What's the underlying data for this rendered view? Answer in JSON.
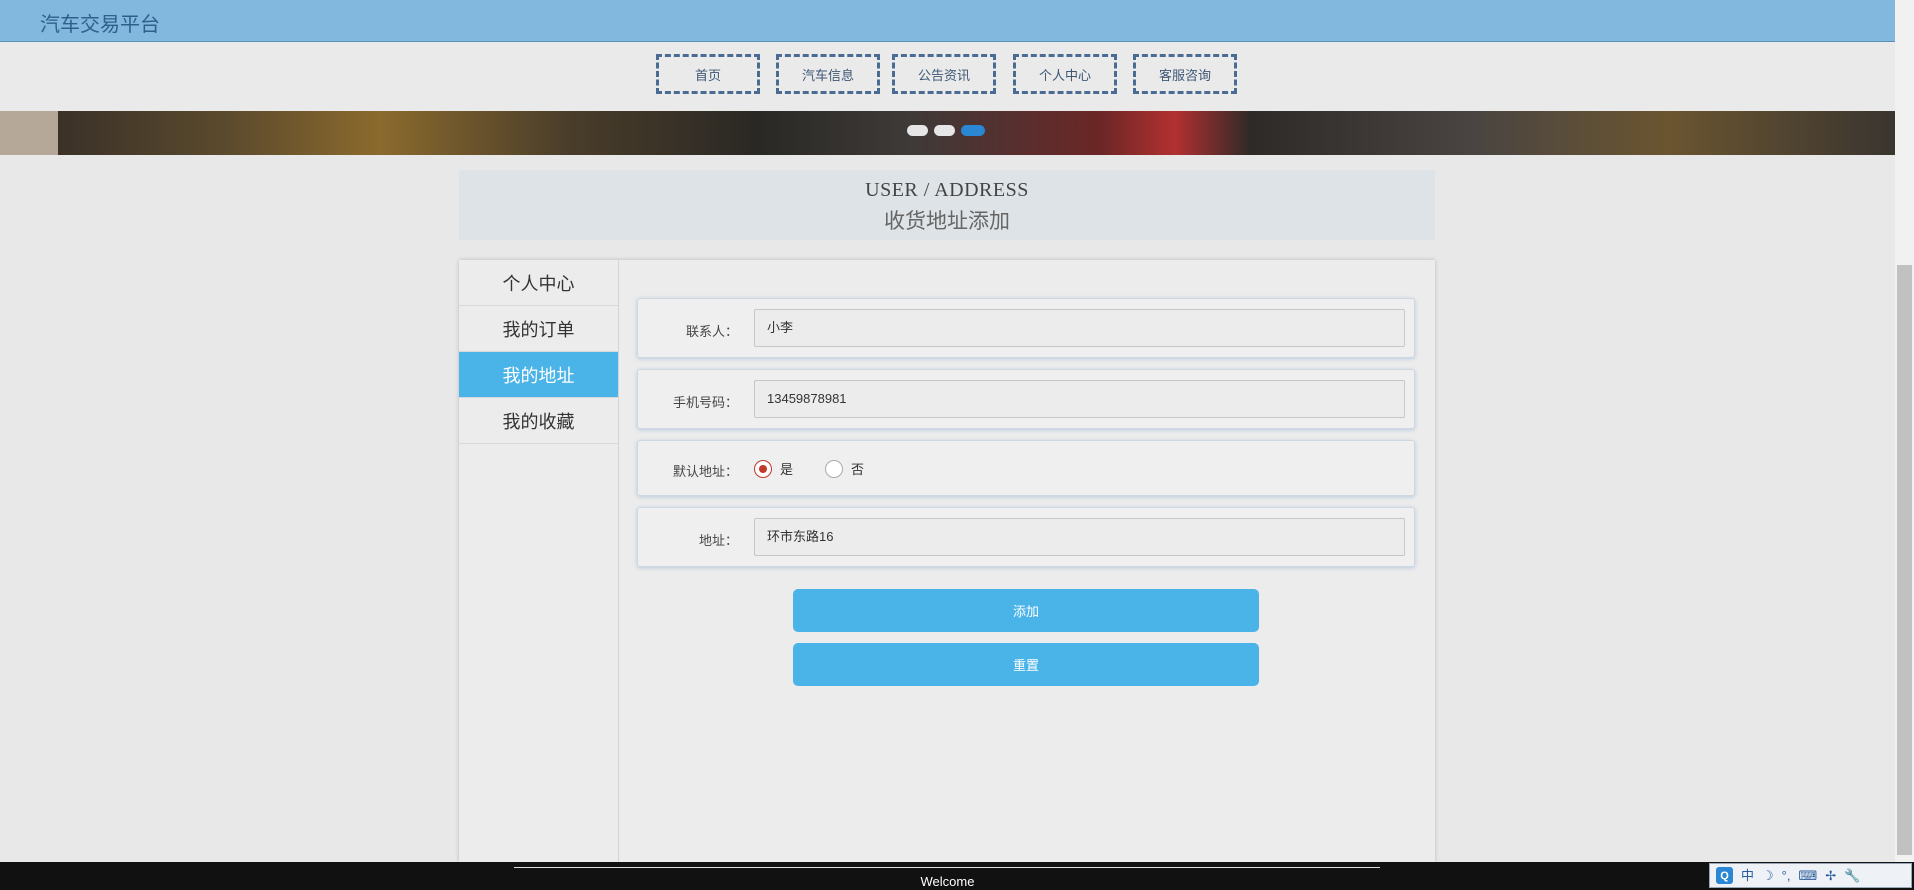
{
  "header": {
    "site_title": "汽车交易平台"
  },
  "nav": {
    "items": [
      "首页",
      "汽车信息",
      "公告资讯",
      "个人中心",
      "客服咨询"
    ]
  },
  "heading": {
    "en": "USER / ADDRESS",
    "cn": "收货地址添加"
  },
  "sidebar": {
    "items": [
      "个人中心",
      "我的订单",
      "我的地址",
      "我的收藏"
    ],
    "active_index": 2
  },
  "form": {
    "contact_label": "联系人：",
    "contact_value": "小李",
    "phone_label": "手机号码：",
    "phone_value": "13459878981",
    "default_label": "默认地址：",
    "option_yes": "是",
    "option_no": "否",
    "default_selected": "是",
    "address_label": "地址：",
    "address_value": "环市东路16",
    "add_button": "添加",
    "reset_button": "重置"
  },
  "footer": {
    "welcome": "Welcome"
  },
  "ime": {
    "logo": "Q",
    "mode": "中",
    "icons": [
      "moon-icon",
      "punctuation-icon",
      "keyboard-icon",
      "tools-icon",
      "wrench-icon"
    ]
  },
  "colors": {
    "topbar": "#82b8dd",
    "accent": "#4ab3e8",
    "radio_checked": "#c0392b"
  }
}
